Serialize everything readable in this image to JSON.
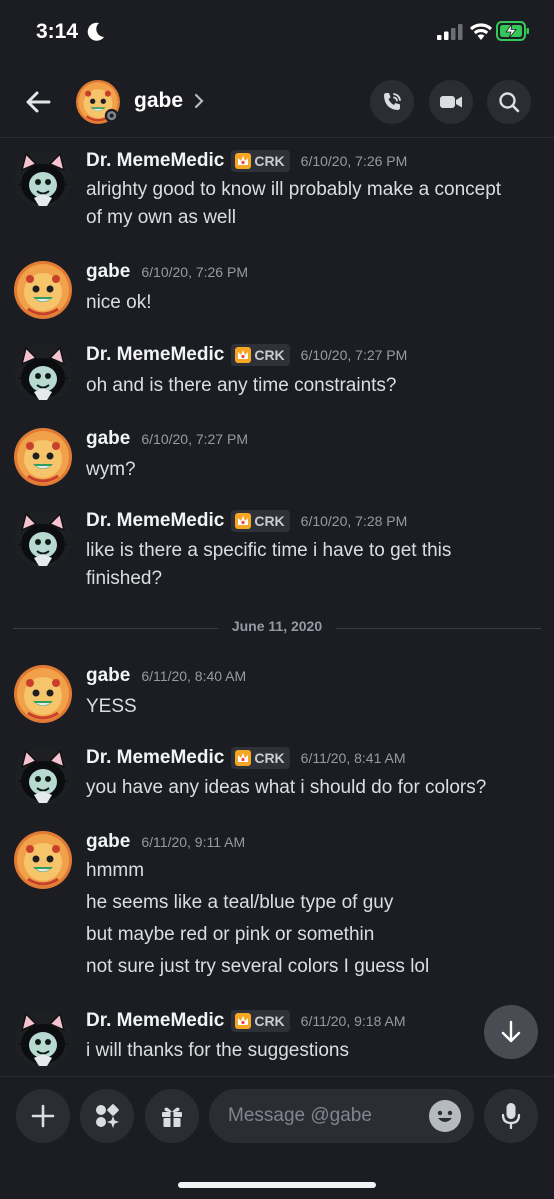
{
  "status_bar": {
    "time": "3:14"
  },
  "header": {
    "name": "gabe"
  },
  "date_divider": "June 11, 2020",
  "messages": [
    {
      "author": "Dr. MemeMedic",
      "tag": "CRK",
      "time": "6/10/20, 7:26 PM",
      "lines": [
        "alrighty good to know ill probably make a concept",
        "of my own as well"
      ]
    },
    {
      "author": "gabe",
      "time": "6/10/20, 7:26 PM",
      "lines": [
        "nice ok!"
      ]
    },
    {
      "author": "Dr. MemeMedic",
      "tag": "CRK",
      "time": "6/10/20, 7:27 PM",
      "lines": [
        "oh and is there any time constraints?"
      ]
    },
    {
      "author": "gabe",
      "time": "6/10/20, 7:27 PM",
      "lines": [
        "wym?"
      ]
    },
    {
      "author": "Dr. MemeMedic",
      "tag": "CRK",
      "time": "6/10/20, 7:28 PM",
      "lines": [
        "like is there a specific time i have to get this",
        "finished?"
      ]
    },
    {
      "author": "gabe",
      "time": "6/11/20, 8:40 AM",
      "lines": [
        "YESS"
      ]
    },
    {
      "author": "Dr. MemeMedic",
      "tag": "CRK",
      "time": "6/11/20, 8:41 AM",
      "lines": [
        "you have any ideas what i should do for colors?"
      ]
    },
    {
      "author": "gabe",
      "time": "6/11/20, 9:11 AM",
      "lines": [
        "hmmm",
        "he seems like a teal/blue type of guy",
        "but maybe red or pink or somethin",
        "not sure just try several colors I guess lol"
      ]
    },
    {
      "author": "Dr. MemeMedic",
      "tag": "CRK",
      "time": "6/11/20, 9:18 AM",
      "lines": [
        "i will thanks for the suggestions"
      ]
    }
  ],
  "composer": {
    "placeholder": "Message @gabe"
  },
  "icons": {
    "back": "arrow-left-icon",
    "call": "phone-call-icon",
    "video": "video-camera-icon",
    "search": "search-icon",
    "add": "plus-icon",
    "apps": "apps-icon",
    "gift": "gift-icon",
    "emoji": "emoji-icon",
    "mic": "microphone-icon",
    "scroll": "arrow-down-icon",
    "tag": "crown-badge-icon"
  },
  "colors": {
    "background": "#1c1d22",
    "surface": "#2b2d33",
    "text": "#dbdee1",
    "muted": "#949ba4",
    "online": "#23a55a"
  }
}
